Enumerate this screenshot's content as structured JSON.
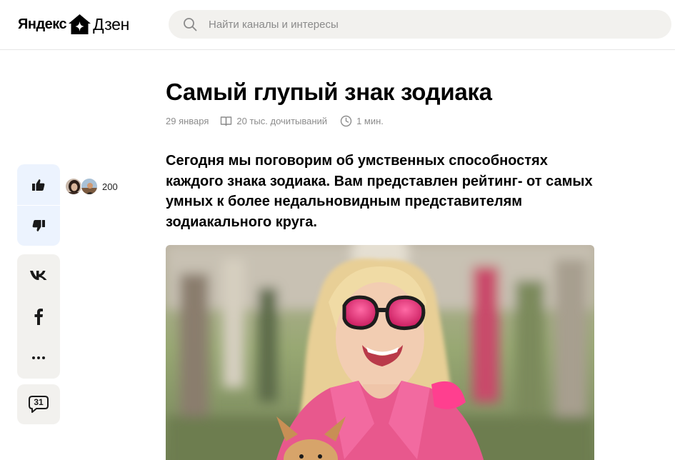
{
  "header": {
    "logo": {
      "left_text": "Яндекс",
      "right_text": "Дзен"
    },
    "search": {
      "placeholder": "Найти каналы и интересы"
    }
  },
  "article": {
    "title": "Самый глупый знак зодиака",
    "date": "29 января",
    "reads": "20 тыс. дочитываний",
    "read_time": "1 мин.",
    "lead": "Сегодня мы поговорим об умственных способностях каждого знака зодиака. Вам представлен рейтинг- от самых умных к более недальновидным представителям зодиакального круга."
  },
  "sidebar": {
    "like_count": "200",
    "comments_count": "31",
    "icons": {
      "like": "thumbs-up-icon",
      "dislike": "thumbs-down-icon",
      "vk": "vk-icon",
      "facebook": "facebook-icon",
      "more": "more-dots-icon",
      "comments": "comment-bubble-icon"
    }
  },
  "colors": {
    "search_bg": "#f2f1ee",
    "reactions_bg": "#ecf3fe",
    "share_bg": "#f2f1ee",
    "meta_text": "#8c8c8c"
  }
}
